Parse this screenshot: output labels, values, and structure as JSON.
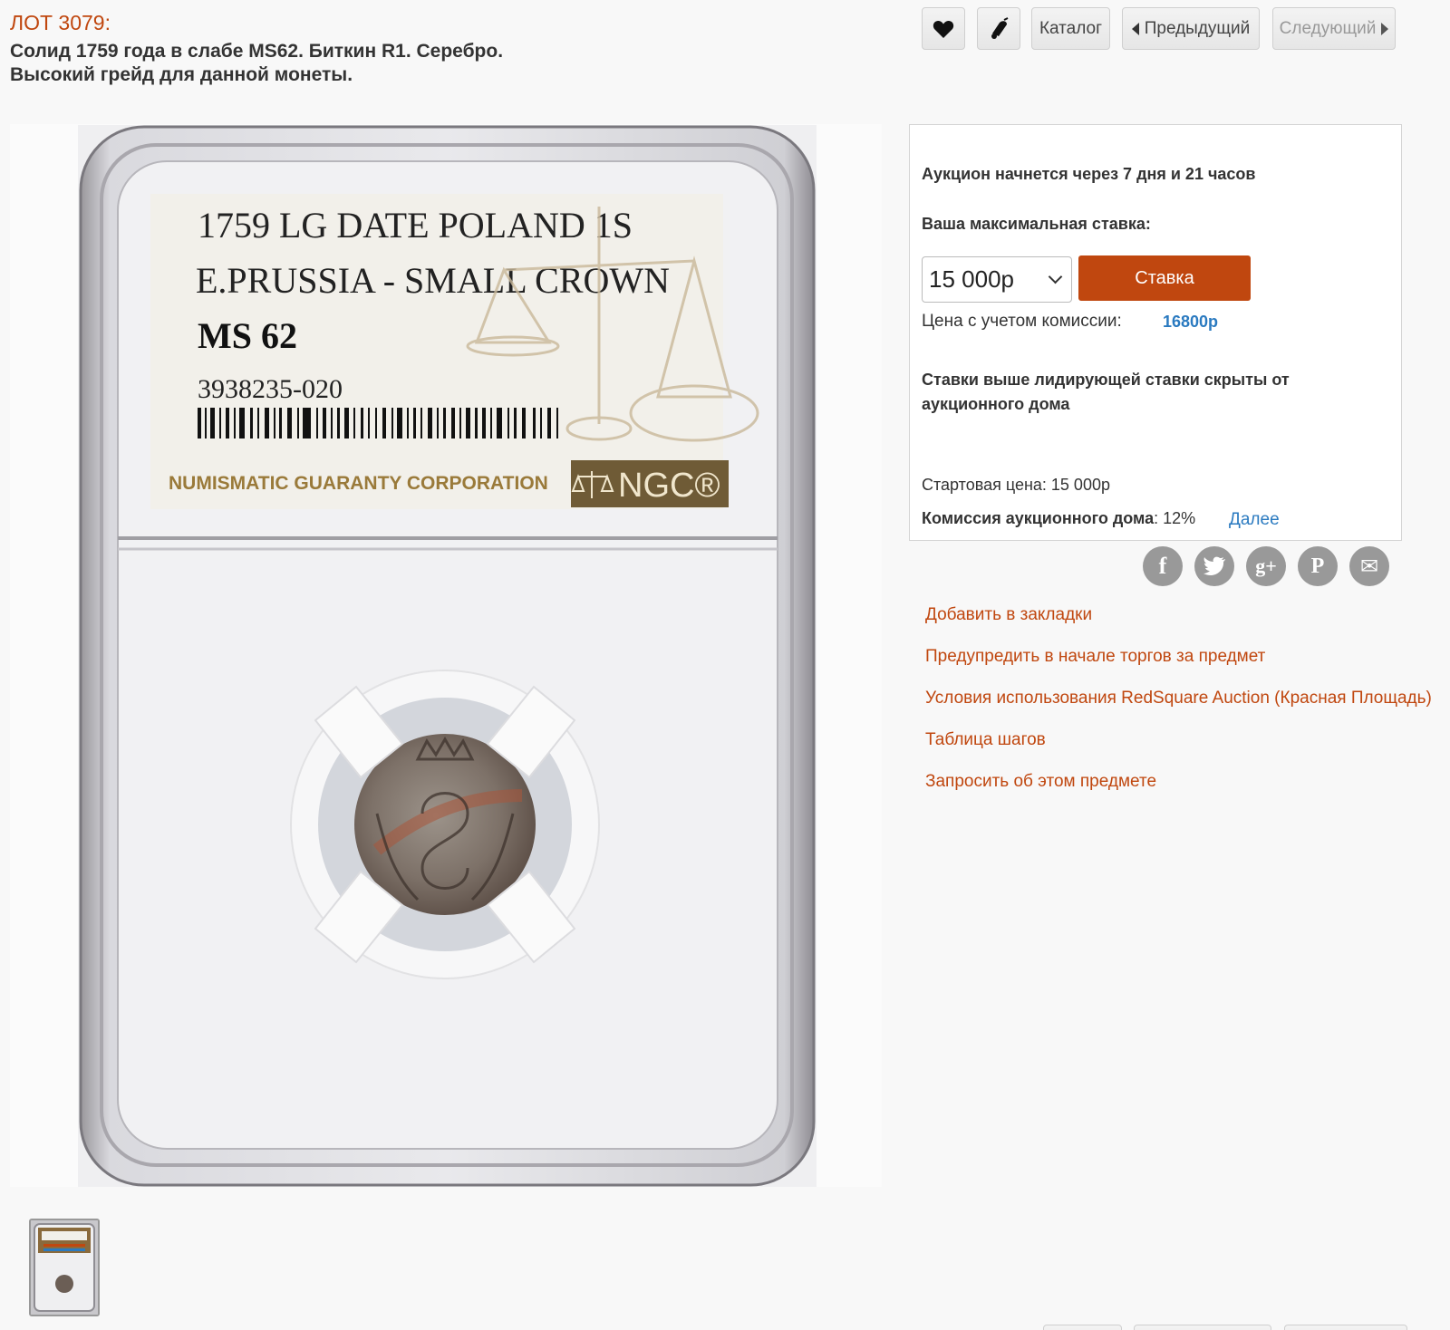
{
  "lot": {
    "number": "ЛОТ 3079:",
    "title": "Солид 1759 года в слабе MS62. Биткин R1. Серебро. Высокий грейд для данной монеты."
  },
  "toolbar": {
    "favorite_icon": "heart-icon",
    "alert_icon": "bell-icon",
    "catalog_label": "Каталог",
    "prev_label": "Предыдущий",
    "next_label": "Следующий"
  },
  "slab": {
    "line1": "1759 LG DATE POLAND 1S",
    "line2": "E.PRUSSIA - SMALL CROWN",
    "grade": "MS 62",
    "cert": "3938235-020",
    "company": "NUMISMATIC GUARANTY CORPORATION",
    "brand": "NGC®"
  },
  "bid": {
    "start_in": "Аукцион начнется через 7 дня и 21 часов",
    "max_label": "Ваша максимальная ставка:",
    "selected_value": "15 000р",
    "button_label": "Ставка",
    "fee_price_label": "Цена с учетом комиссии:",
    "fee_price_value": "16800р",
    "hidden_note": "Ставки выше лидирующей ставки скрыты от аукционного дома",
    "start_price": "Стартовая цена: 15 000р",
    "commission_label": "Комиссия аукционного дома",
    "commission_value": ": 12%",
    "more_link": "Далее"
  },
  "social": [
    {
      "name": "facebook-icon",
      "glyph": "f"
    },
    {
      "name": "twitter-icon",
      "glyph": "t"
    },
    {
      "name": "google-plus-icon",
      "glyph": "g+"
    },
    {
      "name": "pinterest-icon",
      "glyph": "P"
    },
    {
      "name": "email-icon",
      "glyph": "✉"
    }
  ],
  "links": [
    "Добавить в закладки",
    "Предупредить в начале торгов за предмет",
    "Условия использования RedSquare Auction (Красная Площадь)",
    "Таблица шагов",
    "Запросить об этом предмете"
  ],
  "colors": {
    "accent": "#c0470f",
    "link_blue": "#2a7ac0"
  }
}
